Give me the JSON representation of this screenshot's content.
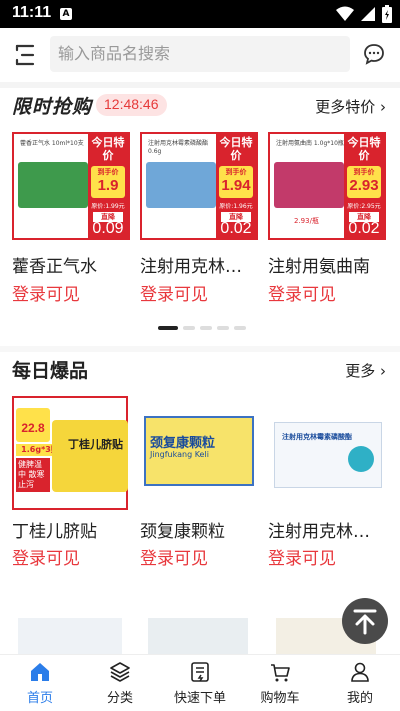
{
  "status_bar": {
    "time": "11:11",
    "notif_letter": "A"
  },
  "header": {
    "search_placeholder": "输入商品名搜索"
  },
  "flash_sale": {
    "title": "限时抢购",
    "countdown": "12:48:46",
    "more_label": "更多特价",
    "products": [
      {
        "name": "藿香正气水",
        "login": "登录可见",
        "box_label": "藿香正气水 10ml*10支",
        "today": "今日特价",
        "to_hand": "到手价",
        "price": "1.9",
        "original": "原价:1.99元",
        "drop": "直降",
        "reduce": "0.09",
        "box_color": "#3e9a4c"
      },
      {
        "name": "注射用克林…",
        "login": "登录可见",
        "box_label": "注射用克林霉素磷酸酯 0.6g",
        "today": "今日特价",
        "to_hand": "到手价",
        "price": "1.94",
        "original": "原价:1.96元",
        "drop": "直降",
        "reduce": "0.02",
        "box_color": "#6fa7d8"
      },
      {
        "name": "注射用氨曲南",
        "login": "登录可见",
        "box_label": "注射用氨曲南 1.0g*10瓶",
        "today": "今日特价",
        "to_hand": "到手价",
        "price": "2.93",
        "original": "原价:2.95元",
        "drop": "直降",
        "reduce": "0.02",
        "box_color": "#c23a6a",
        "note": "2.93/瓶"
      }
    ],
    "pager": {
      "count": 5,
      "active": 0
    }
  },
  "daily": {
    "title": "每日爆品",
    "more_label": "更多",
    "products": [
      {
        "name": "丁桂儿脐贴",
        "login": "登录可见",
        "promo_price": "22.8",
        "promo_spec": "1.6g*3贴",
        "box_text": "丁桂儿脐贴",
        "tag": "健脾温中 散寒止泻"
      },
      {
        "name": "颈复康颗粒",
        "login": "登录可见",
        "box_text": "颈复康颗粒",
        "sub": "Jingfukang Keli"
      },
      {
        "name": "注射用克林…",
        "login": "登录可见",
        "box_text": "注射用克林霉素磷酸酯"
      }
    ]
  },
  "tabs": [
    {
      "label": "首页",
      "icon": "home-icon",
      "active": true
    },
    {
      "label": "分类",
      "icon": "layers-icon",
      "active": false
    },
    {
      "label": "快速下单",
      "icon": "order-icon",
      "active": false
    },
    {
      "label": "购物车",
      "icon": "cart-icon",
      "active": false
    },
    {
      "label": "我的",
      "icon": "user-icon",
      "active": false
    }
  ],
  "colors": {
    "accent": "#2b7de9",
    "red": "#e8383d",
    "promo_red": "#d9232d",
    "yellow": "#ffe14a"
  }
}
